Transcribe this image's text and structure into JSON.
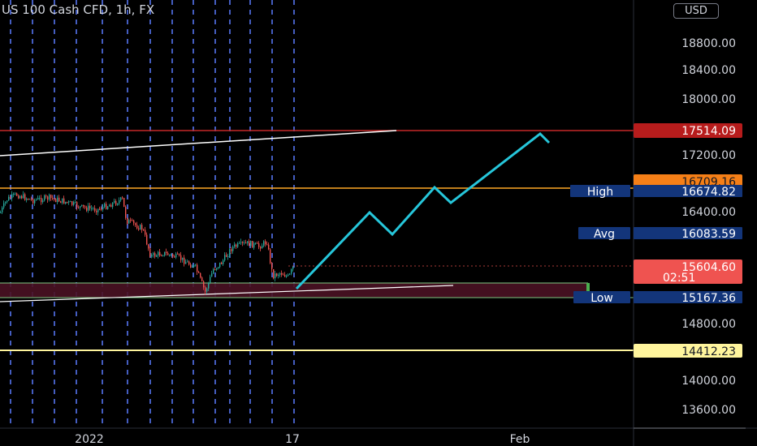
{
  "symbol": {
    "title": "US 100 Cash CFD, 1h, FX"
  },
  "price_axis": {
    "currency": "USD",
    "ticks": [
      "18800.00",
      "18400.00",
      "18000.00",
      "17200.00",
      "16400.00",
      "14800.00",
      "14000.00",
      "13600.00"
    ]
  },
  "time_axis": {
    "ticks": [
      "2022",
      "17",
      "Feb"
    ]
  },
  "levels": {
    "resistance": {
      "value": "17514.09",
      "color": "#b71c1c"
    },
    "high_tag": {
      "value": "16709.16",
      "color": "#f57f17"
    },
    "high": {
      "label": "High",
      "value": "16674.82"
    },
    "avg": {
      "label": "Avg",
      "value": "16083.59"
    },
    "current": {
      "value": "15604.60",
      "countdown": "02:51",
      "color": "#ef5350"
    },
    "low": {
      "label": "Low",
      "value": "15167.36"
    },
    "support": {
      "value": "14412.23",
      "color": "#ffeb3b"
    }
  },
  "colors": {
    "background": "#000000",
    "projection": "#26c6da",
    "grid_dash": "#2962ff",
    "label_blue": "#13357a"
  }
}
